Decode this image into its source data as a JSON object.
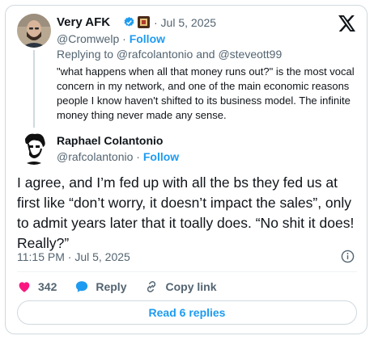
{
  "quoted_post": {
    "author_name": "Very AFK",
    "date": "· Jul 5, 2025",
    "handle": "@Cromwelp",
    "follow_label": "Follow",
    "replying_to": "Replying to @rafcolantonio and @steveott99",
    "text": "\"what happens when all that money runs out?\" is the most vocal concern in my network, and one of the main economic reasons people I know haven't shifted to its business model. The infinite money thing never made any sense."
  },
  "main_post": {
    "author_name": "Raphael Colantonio",
    "handle": "@rafcolantonio",
    "follow_label": "Follow",
    "text": "I agree, and I’m fed up with all the bs they fed us at first like “don’t worry, it doesn’t impact the sales”, only to admit years later that it toally does. “No shit it does! Really?”",
    "timestamp": "11:15 PM · Jul 5, 2025"
  },
  "actions": {
    "like_count": "342",
    "reply_label": "Reply",
    "copy_link_label": "Copy link"
  },
  "read_replies_label": "Read 6 replies",
  "colors": {
    "accent": "#1d9bf0",
    "like": "#f91880",
    "verified": "#1d9bf0"
  },
  "icons": [
    "verified-badge-icon",
    "x-logo-icon",
    "info-icon",
    "heart-icon",
    "reply-bubble-icon",
    "link-icon"
  ]
}
